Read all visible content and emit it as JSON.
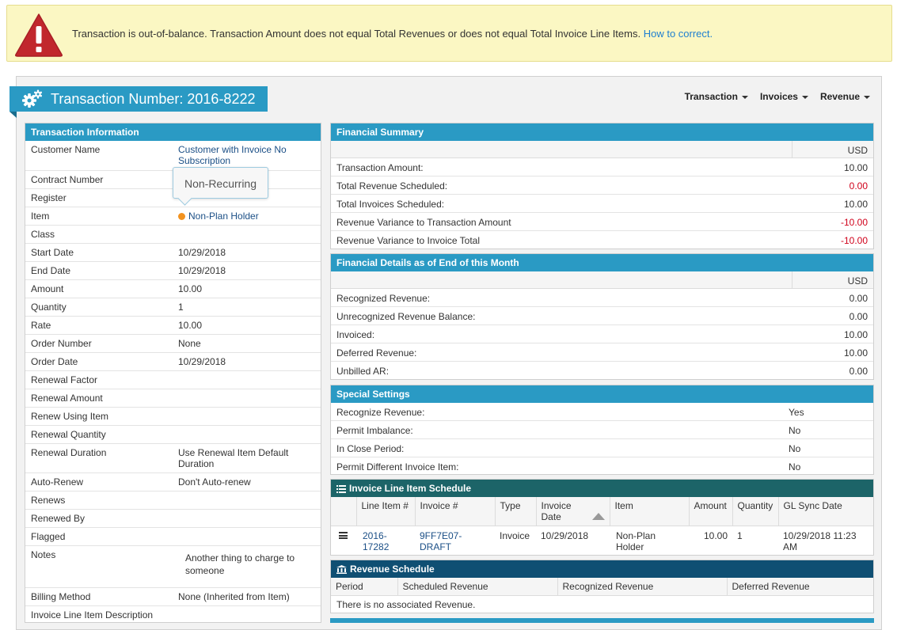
{
  "alert": {
    "message": "Transaction is out-of-balance. Transaction Amount does not equal Total Revenues or does not equal Total Invoice Line Items.",
    "link": "How to correct."
  },
  "header": {
    "title": "Transaction Number: 2016-8222",
    "nav": [
      "Transaction",
      "Invoices",
      "Revenue"
    ]
  },
  "transaction_info": {
    "heading": "Transaction Information",
    "tooltip": "Non-Recurring",
    "rows": [
      {
        "label": "Customer Name",
        "value": "Customer with Invoice No Subscription",
        "link": true
      },
      {
        "label": "Contract Number",
        "value": ""
      },
      {
        "label": "Register",
        "value": ""
      },
      {
        "label": "Item",
        "value": "Non-Plan Holder",
        "link": true,
        "dot": true
      },
      {
        "label": "Class",
        "value": ""
      },
      {
        "label": "Start Date",
        "value": "10/29/2018"
      },
      {
        "label": "End Date",
        "value": "10/29/2018"
      },
      {
        "label": "Amount",
        "value": "10.00"
      },
      {
        "label": "Quantity",
        "value": "1"
      },
      {
        "label": "Rate",
        "value": "10.00"
      },
      {
        "label": "Order Number",
        "value": "None"
      },
      {
        "label": "Order Date",
        "value": "10/29/2018"
      },
      {
        "label": "Renewal Factor",
        "value": ""
      },
      {
        "label": "Renewal Amount",
        "value": ""
      },
      {
        "label": "Renew Using Item",
        "value": ""
      },
      {
        "label": "Renewal Quantity",
        "value": ""
      },
      {
        "label": "Renewal Duration",
        "value": "Use Renewal Item Default Duration"
      },
      {
        "label": "Auto-Renew",
        "value": "Don't Auto-renew"
      },
      {
        "label": "Renews",
        "value": ""
      },
      {
        "label": "Renewed By",
        "value": ""
      },
      {
        "label": "Flagged",
        "value": ""
      },
      {
        "label": "Notes",
        "value": "Another thing to charge to someone"
      },
      {
        "label": "Billing Method",
        "value": "None (Inherited from Item)"
      },
      {
        "label": "Invoice Line Item Description",
        "value": ""
      }
    ]
  },
  "financial_summary": {
    "heading": "Financial Summary",
    "currency": "USD",
    "rows": [
      {
        "label": "Transaction Amount:",
        "value": "10.00",
        "negative": false
      },
      {
        "label": "Total Revenue Scheduled:",
        "value": "0.00",
        "negative": true
      },
      {
        "label": "Total Invoices Scheduled:",
        "value": "10.00",
        "negative": false
      },
      {
        "label": "Revenue Variance to Transaction Amount",
        "value": "-10.00",
        "negative": true
      },
      {
        "label": "Revenue Variance to Invoice Total",
        "value": "-10.00",
        "negative": true
      }
    ]
  },
  "financial_details": {
    "heading": "Financial Details as of End of this Month",
    "currency": "USD",
    "rows": [
      {
        "label": "Recognized Revenue:",
        "value": "0.00"
      },
      {
        "label": "Unrecognized Revenue Balance:",
        "value": "0.00"
      },
      {
        "label": "Invoiced:",
        "value": "10.00"
      },
      {
        "label": "Deferred Revenue:",
        "value": "10.00"
      },
      {
        "label": "Unbilled AR:",
        "value": "0.00"
      }
    ]
  },
  "special_settings": {
    "heading": "Special Settings",
    "rows": [
      {
        "label": "Recognize Revenue:",
        "value": "Yes"
      },
      {
        "label": "Permit Imbalance:",
        "value": "No"
      },
      {
        "label": "In Close Period:",
        "value": "No"
      },
      {
        "label": "Permit Different Invoice Item:",
        "value": "No"
      }
    ]
  },
  "invoice_schedule": {
    "heading": "Invoice Line Item Schedule",
    "columns": [
      "",
      "Line Item #",
      "Invoice #",
      "Type",
      "Invoice Date",
      "Item",
      "Amount",
      "Quantity",
      "GL Sync Date"
    ],
    "row": {
      "line_item": "2016-17282",
      "invoice": "9FF7E07-DRAFT",
      "type": "Invoice",
      "invoice_date": "10/29/2018",
      "item": "Non-Plan Holder",
      "amount": "10.00",
      "quantity": "1",
      "gl_sync_date": "10/29/2018 11:23 AM"
    }
  },
  "revenue_schedule": {
    "heading": "Revenue Schedule",
    "columns": [
      "Period",
      "Scheduled Revenue",
      "Recognized Revenue",
      "Deferred Revenue"
    ],
    "empty_message": "There is no associated Revenue."
  },
  "colors": {
    "header_blue": "#2a9ac4",
    "teal_header": "#1c6468",
    "navy_header": "#0f4f73",
    "alert_bg": "#fbf7c3",
    "negative": "#d0021b"
  }
}
